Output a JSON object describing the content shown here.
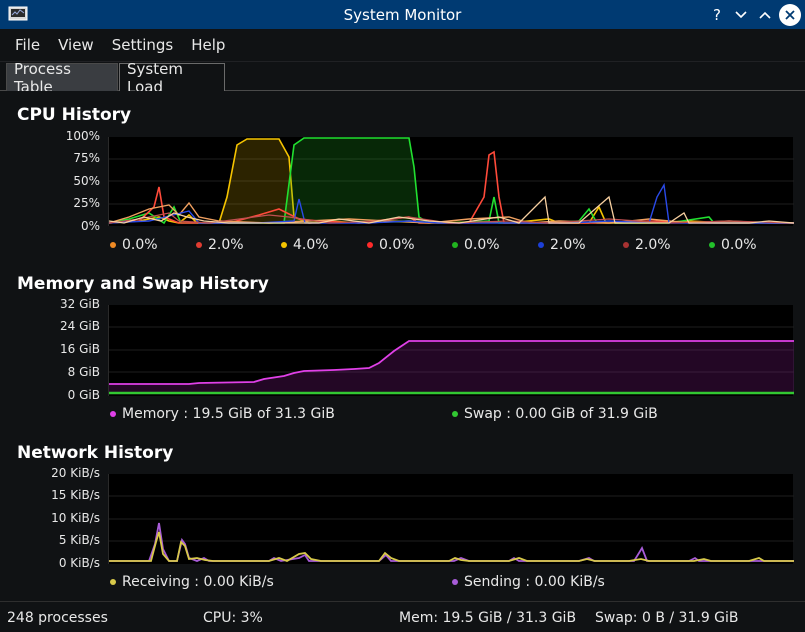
{
  "window": {
    "title": "System Monitor"
  },
  "menu": [
    "File",
    "View",
    "Settings",
    "Help"
  ],
  "tabs": {
    "process_table": "Process Table",
    "system_load": "System Load"
  },
  "cpu": {
    "title": "CPU History",
    "yticks": [
      "100%",
      "75%",
      "50%",
      "25%",
      "0%"
    ],
    "cores": [
      {
        "value": "0.0%",
        "color": "#f08a24"
      },
      {
        "value": "2.0%",
        "color": "#e03c31"
      },
      {
        "value": "4.0%",
        "color": "#f5c400"
      },
      {
        "value": "0.0%",
        "color": "#ff2a2a"
      },
      {
        "value": "0.0%",
        "color": "#21b41f"
      },
      {
        "value": "2.0%",
        "color": "#1c3fd8"
      },
      {
        "value": "2.0%",
        "color": "#a83232"
      },
      {
        "value": "0.0%",
        "color": "#22c02a"
      }
    ]
  },
  "memory": {
    "title": "Memory and Swap History",
    "yticks": [
      "32 GiB",
      "24 GiB",
      "16 GiB",
      "8 GiB",
      "0 GiB"
    ],
    "memory_label": "Memory : 19.5 GiB of 31.3 GiB",
    "swap_label": "Swap : 0.00 GiB of 31.9 GiB",
    "memory_color": "#e040e8",
    "swap_color": "#32c832"
  },
  "network": {
    "title": "Network History",
    "yticks": [
      "20 KiB/s",
      "15 KiB/s",
      "10 KiB/s",
      "5 KiB/s",
      "0 KiB/s"
    ],
    "receiving_label": "Receiving : 0.00 KiB/s",
    "sending_label": "Sending : 0.00 KiB/s",
    "receiving_color": "#d8c94a",
    "sending_color": "#a85cd8"
  },
  "status": {
    "processes": "248 processes",
    "cpu": "CPU: 3%",
    "mem": "Mem: 19.5 GiB / 31.3 GiB",
    "swap": "Swap: 0 B / 31.9 GiB"
  }
}
